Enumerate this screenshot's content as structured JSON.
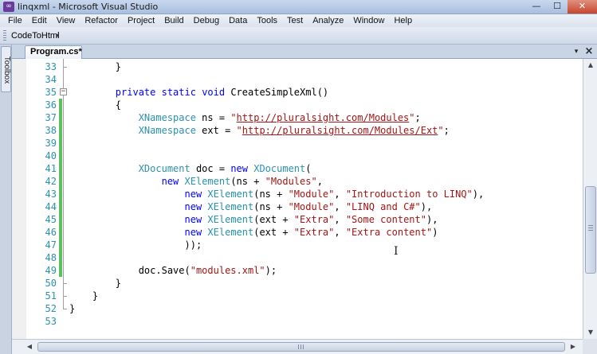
{
  "window": {
    "title": "linqxml - Microsoft Visual Studio",
    "app_icon": "visual-studio-icon",
    "minimize_glyph": "—",
    "maximize_glyph": "☐",
    "close_glyph": "✕"
  },
  "menu": [
    "File",
    "Edit",
    "View",
    "Refactor",
    "Project",
    "Build",
    "Debug",
    "Data",
    "Tools",
    "Test",
    "Analyze",
    "Window",
    "Help"
  ],
  "toolbar": {
    "codetohtml_label": "CodeToHtml",
    "overflow_glyph": "▾"
  },
  "toolbox": {
    "label": "Toolbox"
  },
  "tabs": {
    "active_label": "Program.cs*",
    "dropdown_glyph": "▾",
    "close_glyph": "×"
  },
  "editor": {
    "line_numbers": [
      "33",
      "34",
      "35",
      "36",
      "37",
      "38",
      "39",
      "40",
      "41",
      "42",
      "43",
      "44",
      "45",
      "46",
      "47",
      "48",
      "49",
      "50",
      "51",
      "52",
      "53"
    ],
    "code_lines": [
      "        }",
      "",
      "        private static void CreateSimpleXml()",
      "        {",
      "            XNamespace ns = \"http://pluralsight.com/Modules\";",
      "            XNamespace ext = \"http://pluralsight.com/Modules/Ext\";",
      "",
      "",
      "            XDocument doc = new XDocument(",
      "                new XElement(ns + \"Modules\",",
      "                    new XElement(ns + \"Module\", \"Introduction to LINQ\"),",
      "                    new XElement(ns + \"Module\", \"LINQ and C#\"),",
      "                    new XElement(ext + \"Extra\", \"Some content\"),",
      "                    new XElement(ext + \"Extra\", \"Extra content\")",
      "                    ));",
      "",
      "            doc.Save(\"modules.xml\");",
      "        }",
      "    }",
      "}",
      ""
    ],
    "modified_lines": [
      "36",
      "37",
      "38",
      "39",
      "40",
      "41",
      "42",
      "43",
      "44",
      "45",
      "46",
      "47",
      "48",
      "49"
    ],
    "colors": {
      "keyword": "#0000ff",
      "type": "#2b91af",
      "string": "#a31515",
      "line_number": "#2b91af",
      "change_marker": "#5bc05b"
    }
  },
  "scrollbars": {
    "up_glyph": "▲",
    "down_glyph": "▼",
    "left_glyph": "◀",
    "right_glyph": "▶"
  }
}
